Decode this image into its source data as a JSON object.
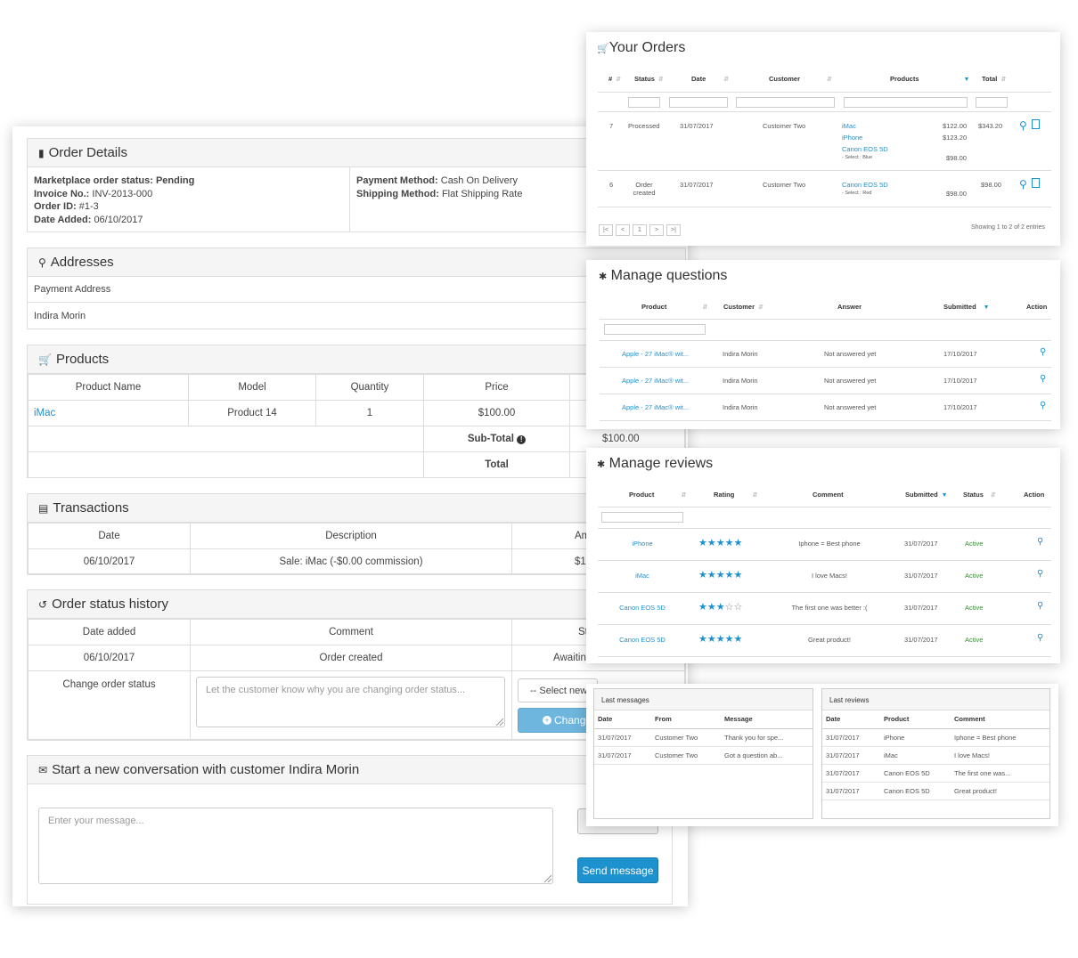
{
  "order_details": {
    "title": "Order Details",
    "status_label": "Marketplace order status:",
    "status_value": "Pending",
    "invoice_label": "Invoice No.:",
    "invoice_value": "INV-2013-000",
    "order_id_label": "Order ID:",
    "order_id_value": "#1-3",
    "date_label": "Date Added:",
    "date_value": "06/10/2017",
    "payment_label": "Payment Method:",
    "payment_value": "Cash On Delivery",
    "shipping_label": "Shipping Method:",
    "shipping_value": "Flat Shipping Rate"
  },
  "addresses": {
    "title": "Addresses",
    "payment_label": "Payment Address",
    "name": "Indira Morin"
  },
  "products": {
    "title": "Products",
    "headers": [
      "Product Name",
      "Model",
      "Quantity",
      "Price"
    ],
    "row": {
      "name": "iMac",
      "model": "Product 14",
      "qty": "1",
      "price": "$100.00"
    },
    "subtotal_label": "Sub-Total",
    "subtotal_value": "$100.00",
    "total_label": "Total"
  },
  "transactions": {
    "title": "Transactions",
    "headers": [
      "Date",
      "Description",
      "Am"
    ],
    "row": {
      "date": "06/10/2017",
      "desc": "Sale: iMac (-$0.00 commission)",
      "amount": "$1"
    }
  },
  "history": {
    "title": "Order status history",
    "headers": [
      "Date added",
      "Comment",
      "St"
    ],
    "row": {
      "date": "06/10/2017",
      "comment": "Order created",
      "status": "Awaitin"
    },
    "change_label": "Change order status",
    "comment_placeholder": "Let the customer know why you are changing order status...",
    "select_value": "-- Select new",
    "change_button": "Change"
  },
  "conversation": {
    "title": "Start a new conversation with customer Indira Morin",
    "placeholder": "Enter your message...",
    "send_button": "Send message"
  },
  "orders": {
    "title": "Your Orders",
    "headers": [
      "#",
      "Status",
      "Date",
      "Customer",
      "Products",
      "Total"
    ],
    "rows": [
      {
        "id": "7",
        "status": "Processed",
        "date": "31/07/2017",
        "customer": "Customer Two",
        "p1": "iMac",
        "p1_price": "$122.00",
        "p2": "iPhone",
        "p2_price": "$123.20",
        "p3": "Canon EOS 5D",
        "p3_opt": "- Select : Blue",
        "p3_price": "$98.00",
        "total": "$343.20"
      },
      {
        "id": "6",
        "status": "Order created",
        "date": "31/07/2017",
        "customer": "Customer Two",
        "p1": "Canon EOS 5D",
        "p1_opt": "- Select : Red",
        "p1_price": "$98.00",
        "total": "$98.00"
      }
    ],
    "pager": [
      "|<",
      "<",
      "1",
      ">",
      ">|"
    ],
    "showing": "Showing 1 to 2 of 2 entries"
  },
  "questions": {
    "title": "Manage questions",
    "headers": [
      "Product",
      "Customer",
      "Answer",
      "Submitted",
      "Action"
    ],
    "rows": [
      {
        "product": "Apple - 27 iMac® wit...",
        "customer": "Indira Morin",
        "answer": "Not answered yet",
        "date": "17/10/2017"
      },
      {
        "product": "Apple - 27 iMac® wit...",
        "customer": "Indira Morin",
        "answer": "Not answered yet",
        "date": "17/10/2017"
      },
      {
        "product": "Apple - 27 iMac® wit...",
        "customer": "Indira Morin",
        "answer": "Not answered yet",
        "date": "17/10/2017"
      }
    ]
  },
  "reviews": {
    "title": "Manage reviews",
    "headers": [
      "Product",
      "Rating",
      "Comment",
      "Submitted",
      "Status",
      "Action"
    ],
    "rows": [
      {
        "product": "iPhone",
        "rating": 5,
        "comment": "Iphone = Best phone",
        "date": "31/07/2017",
        "status": "Active"
      },
      {
        "product": "iMac",
        "rating": 5,
        "comment": "I love Macs!",
        "date": "31/07/2017",
        "status": "Active"
      },
      {
        "product": "Canon EOS 5D",
        "rating": 3,
        "comment": "The first one was better :(",
        "date": "31/07/2017",
        "status": "Active"
      },
      {
        "product": "Canon EOS 5D",
        "rating": 5,
        "comment": "Great product!",
        "date": "31/07/2017",
        "status": "Active"
      }
    ]
  },
  "last_messages": {
    "title": "Last messages",
    "headers": [
      "Date",
      "From",
      "Message"
    ],
    "rows": [
      {
        "date": "31/07/2017",
        "from": "Customer Two",
        "message": "Thank you for spe..."
      },
      {
        "date": "31/07/2017",
        "from": "Customer Two",
        "message": "Got a question ab..."
      }
    ]
  },
  "last_reviews": {
    "title": "Last reviews",
    "headers": [
      "Date",
      "Product",
      "Comment"
    ],
    "rows": [
      {
        "date": "31/07/2017",
        "product": "iPhone",
        "comment": "Iphone = Best phone"
      },
      {
        "date": "31/07/2017",
        "product": "iMac",
        "comment": "I love Macs!"
      },
      {
        "date": "31/07/2017",
        "product": "Canon EOS 5D",
        "comment": "The first one was..."
      },
      {
        "date": "31/07/2017",
        "product": "Canon EOS 5D",
        "comment": "Great product!"
      }
    ]
  }
}
